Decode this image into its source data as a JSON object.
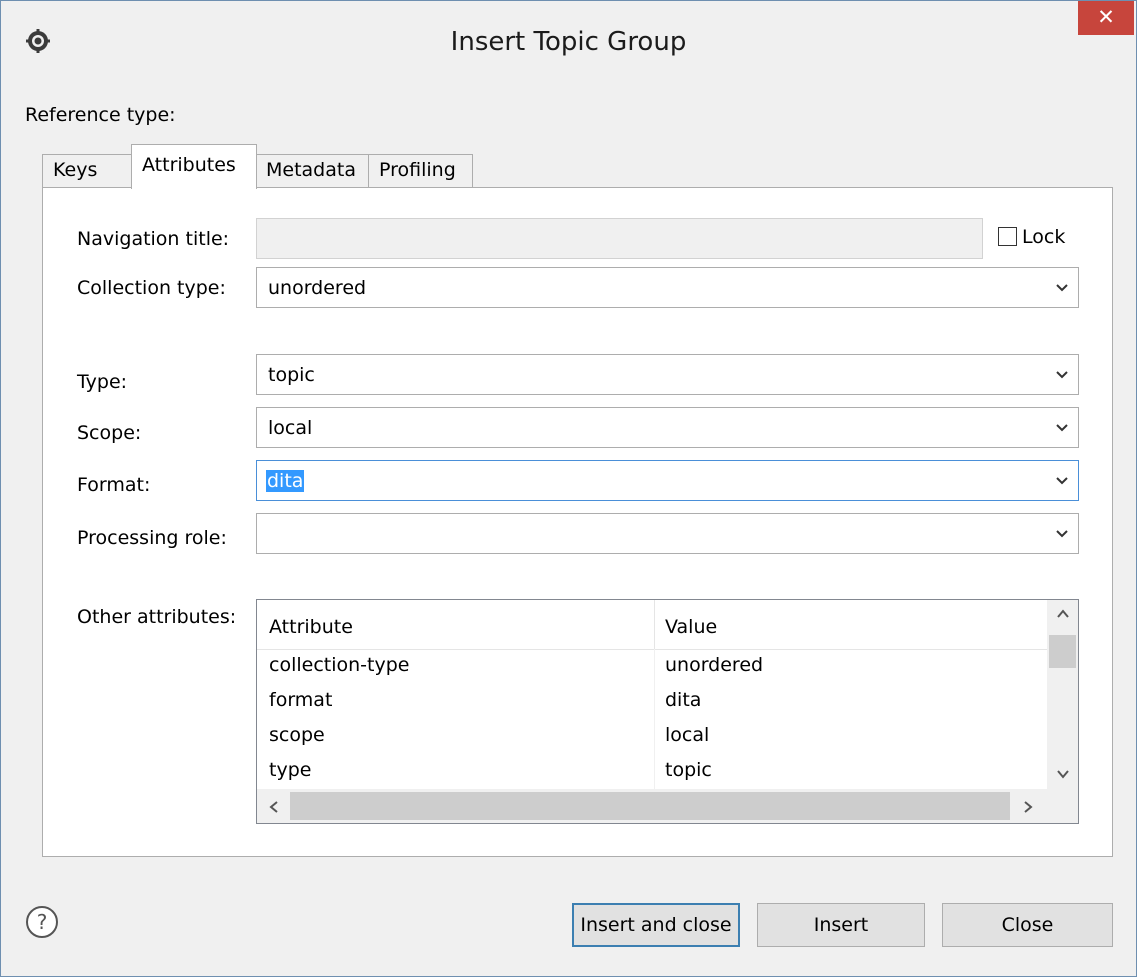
{
  "window": {
    "title": "Insert Topic Group",
    "close_label": "✕"
  },
  "reference_type_label": "Reference type:",
  "tabs": [
    {
      "label": "Keys",
      "active": false
    },
    {
      "label": "Attributes",
      "active": true
    },
    {
      "label": "Metadata",
      "active": false
    },
    {
      "label": "Profiling",
      "active": false
    }
  ],
  "form": {
    "navigation_title": {
      "label": "Navigation title:",
      "value": "",
      "disabled": true
    },
    "lock": {
      "label": "Lock",
      "checked": false
    },
    "collection_type": {
      "label": "Collection type:",
      "value": "unordered"
    },
    "type": {
      "label": "Type:",
      "value": "topic"
    },
    "scope": {
      "label": "Scope:",
      "value": "local"
    },
    "format": {
      "label": "Format:",
      "value": "dita"
    },
    "processing_role": {
      "label": "Processing role:",
      "value": ""
    },
    "other_attributes_label": "Other attributes:"
  },
  "attributes_table": {
    "headers": [
      "Attribute",
      "Value"
    ],
    "rows": [
      [
        "collection-type",
        "unordered"
      ],
      [
        "format",
        "dita"
      ],
      [
        "scope",
        "local"
      ],
      [
        "type",
        "topic"
      ]
    ]
  },
  "buttons": {
    "insert_and_close": "Insert and close",
    "insert": "Insert",
    "close": "Close"
  },
  "icons": {
    "app": "gear-icon",
    "help": "help-icon",
    "dropdown": "chevron-down-icon"
  },
  "colors": {
    "close_button": "#c7453c",
    "selection": "#3399ff",
    "focus_border": "#4a8fd8"
  }
}
